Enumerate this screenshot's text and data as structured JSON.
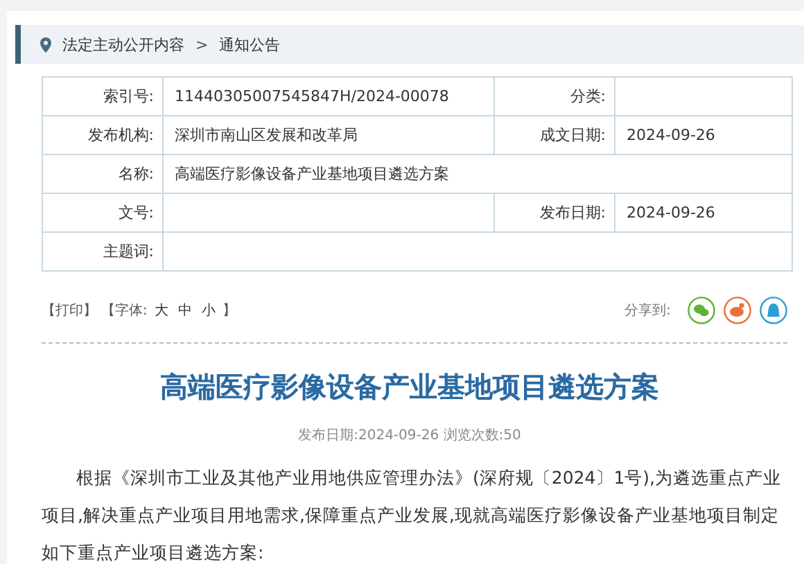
{
  "breadcrumb": {
    "items": [
      "法定主动公开内容",
      "通知公告"
    ],
    "separator": ">"
  },
  "info_table": {
    "rows": [
      {
        "cells": [
          {
            "label": "索引号:",
            "value": "11440305007545847H/2024-00078"
          },
          {
            "label": "分类:"
          }
        ]
      },
      {
        "cells": [
          {
            "label": "发布机构:",
            "value": "深圳市南山区发展和改革局"
          },
          {
            "label": "成文日期:",
            "value": "2024-09-26"
          }
        ]
      },
      {
        "cells": [
          {
            "label": "名称:",
            "value": "高端医疗影像设备产业基地项目遴选方案"
          }
        ]
      },
      {
        "cells": [
          {
            "label": "文号:"
          },
          {
            "label": "发布日期:",
            "value": "2024-09-26"
          }
        ]
      },
      {
        "cells": [
          {
            "label": "主题词:"
          }
        ]
      }
    ]
  },
  "toolbar": {
    "print": "【打印】",
    "font_label": "【字体:",
    "font_sizes": [
      "大",
      "中",
      "小"
    ],
    "font_close": "】",
    "share_label": "分享到:",
    "share_icons": [
      {
        "kind": "wechat",
        "color": "#5fb336"
      },
      {
        "kind": "weibo",
        "color": "#e8703a"
      },
      {
        "kind": "qq",
        "color": "#2b9ed8"
      }
    ]
  },
  "article": {
    "title": "高端医疗影像设备产业基地项目遴选方案",
    "meta": "发布日期:2024-09-26  浏览次数:50",
    "paragraphs": [
      "根据《深圳市工业及其他产业用地供应管理办法》(深府规〔2024〕1号),为遴选重点产业项目,解决重点产业项目用地需求,保障重点产业发展,现就高端医疗影像设备产业基地项目制定如下重点产业项目遴选方案:"
    ]
  }
}
